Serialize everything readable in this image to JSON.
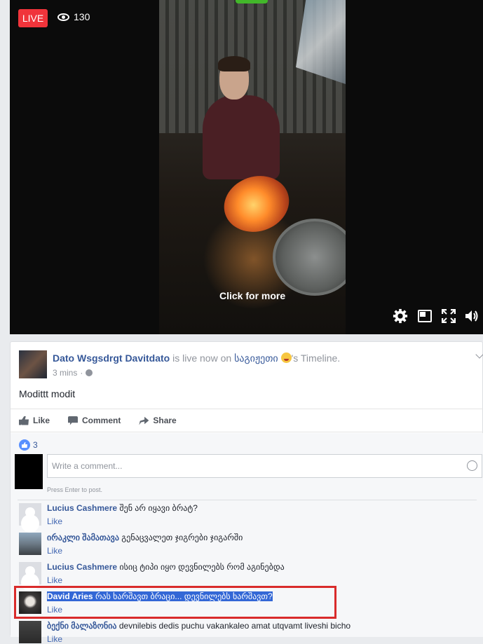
{
  "video": {
    "live_label": "LIVE",
    "viewer_count": "130",
    "click_for_more": "Click for more",
    "icons": [
      "eye-icon",
      "settings-icon",
      "picture-in-picture-icon",
      "fullscreen-icon",
      "volume-icon"
    ]
  },
  "post": {
    "author": "Dato Wsgsdrgt Davitdato",
    "status_text": "is live now on",
    "target_page": "საგიჟეთი",
    "timeline_suffix": "'s Timeline.",
    "time": "3 mins",
    "privacy_icon": "globe-icon",
    "text": "Modittt modit"
  },
  "actions": {
    "like": "Like",
    "comment": "Comment",
    "share": "Share"
  },
  "reactions": {
    "count": "3"
  },
  "composer": {
    "placeholder": "Write a comment...",
    "hint": "Press Enter to post."
  },
  "comments": [
    {
      "name": "Lucius Cashmere",
      "text": "შენ არ იყავი ბრატ?",
      "like": "Like"
    },
    {
      "name": "ირაკლი შამათავა",
      "text": "გენაცვალეთ ჯიგრები ჯიგარში",
      "like": "Like"
    },
    {
      "name": "Lucius Cashmere",
      "text": "ისიც ტიპი იყო დევნილებს რომ აგინებდა",
      "like": "Like"
    },
    {
      "name": "David Aries",
      "text": "რას ხარშავთ ბრაცი... დევნილებს ხარშავთ?",
      "like": "Like"
    },
    {
      "name": "ბექნი მალაზონია",
      "text": "devnilebis dedis puchu vakankaleo amat utqvamt liveshi bicho",
      "like": "Like"
    }
  ],
  "colors": {
    "live_red": "#f0343b",
    "link_blue": "#365899",
    "highlight_blue": "#3367d6",
    "annotation_red": "#d92b2b"
  }
}
